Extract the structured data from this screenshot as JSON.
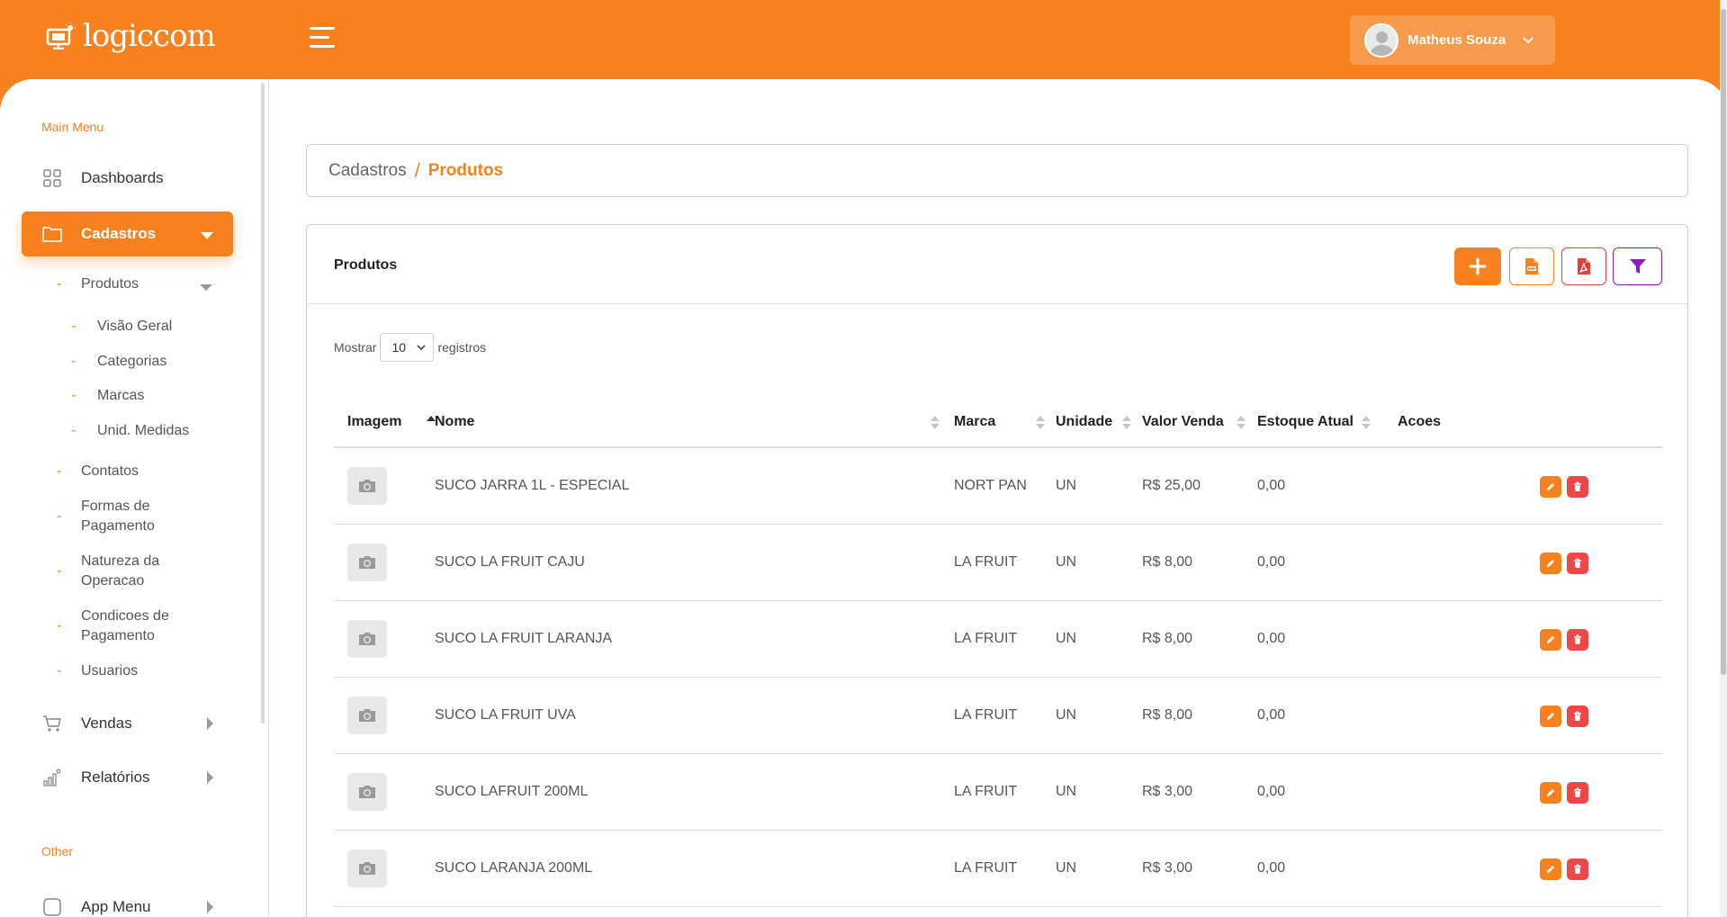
{
  "brand": {
    "logo_text": "logiccom"
  },
  "header": {
    "user_name": "Matheus Souza"
  },
  "sidebar": {
    "main_menu_title": "Main Menu",
    "other_title": "Other",
    "dashboards": "Dashboards",
    "cadastros": "Cadastros",
    "produtos": "Produtos",
    "produtos_sub": [
      "Visão Geral",
      "Categorias",
      "Marcas",
      "Unid. Medidas"
    ],
    "contatos": "Contatos",
    "formas_l1": "Formas de",
    "formas_l2": "Pagamento",
    "natureza_l1": "Natureza da",
    "natureza_l2": "Operacao",
    "condicoes_l1": "Condicoes de",
    "condicoes_l2": "Pagamento",
    "usuarios": "Usuarios",
    "vendas": "Vendas",
    "relatorios": "Relatórios",
    "app_menu": "App Menu"
  },
  "breadcrumb": {
    "parent": "Cadastros",
    "separator": "/",
    "current": "Produtos"
  },
  "card": {
    "title": "Produtos"
  },
  "pagination": {
    "show_label": "Mostrar",
    "page_size": "10",
    "records_label": "registros"
  },
  "table": {
    "columns": [
      "Imagem",
      "Nome",
      "Marca",
      "Unidade",
      "Valor Venda",
      "Estoque Atual",
      "Acoes"
    ],
    "rows": [
      {
        "nome": "SUCO JARRA 1L - ESPECIAL",
        "marca": "NORT PAN",
        "unidade": "UN",
        "valor": "R$ 25,00",
        "estoque": "0,00"
      },
      {
        "nome": "SUCO LA FRUIT CAJU",
        "marca": "LA FRUIT",
        "unidade": "UN",
        "valor": "R$ 8,00",
        "estoque": "0,00"
      },
      {
        "nome": "SUCO LA FRUIT LARANJA",
        "marca": "LA FRUIT",
        "unidade": "UN",
        "valor": "R$ 8,00",
        "estoque": "0,00"
      },
      {
        "nome": "SUCO LA FRUIT UVA",
        "marca": "LA FRUIT",
        "unidade": "UN",
        "valor": "R$ 8,00",
        "estoque": "0,00"
      },
      {
        "nome": "SUCO LAFRUIT 200ML",
        "marca": "LA FRUIT",
        "unidade": "UN",
        "valor": "R$ 3,00",
        "estoque": "0,00"
      },
      {
        "nome": "SUCO LARANJA 200ML",
        "marca": "LA FRUIT",
        "unidade": "UN",
        "valor": "R$ 3,00",
        "estoque": "0,00"
      }
    ]
  },
  "colors": {
    "accent": "#f7801f",
    "danger": "#ef4747",
    "filter": "#8a1fb6"
  }
}
